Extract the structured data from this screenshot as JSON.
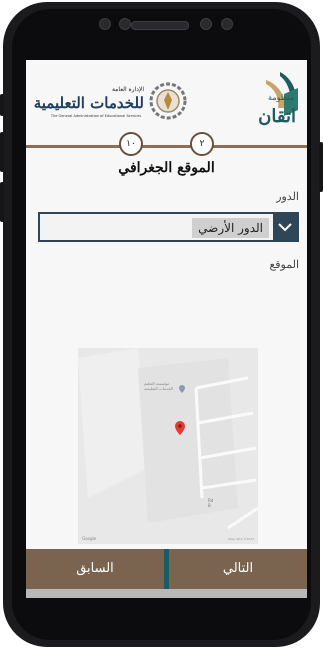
{
  "brand": {
    "itqan_small": "منظومة",
    "itqan_name": "اتقان",
    "gaes_top": "الإدارة العامة",
    "gaes_main": "للخدمات التعليمية",
    "gaes_en": "The General Administration of Educational Services"
  },
  "stepper": {
    "current": "٢",
    "total": "١٠"
  },
  "page": {
    "title": "الموقع الجغرافي"
  },
  "form": {
    "floor_label": "الدور",
    "floor_value": "الدور الأرضي",
    "location_label": "الموقع"
  },
  "map": {
    "google_label": "Google",
    "data_label": "Map data ©2023",
    "poi_line1": "مؤسسة التعليم",
    "poi_line2": "الخدمات التعليمية",
    "small_line1": "Rd",
    "small_line2": "B"
  },
  "footer": {
    "prev_label": "السابق",
    "next_label": "التالي"
  },
  "colors": {
    "brown": "#7b644f",
    "teal": "#1f5b63",
    "navy": "#2f4659",
    "pin": "#e53935"
  }
}
